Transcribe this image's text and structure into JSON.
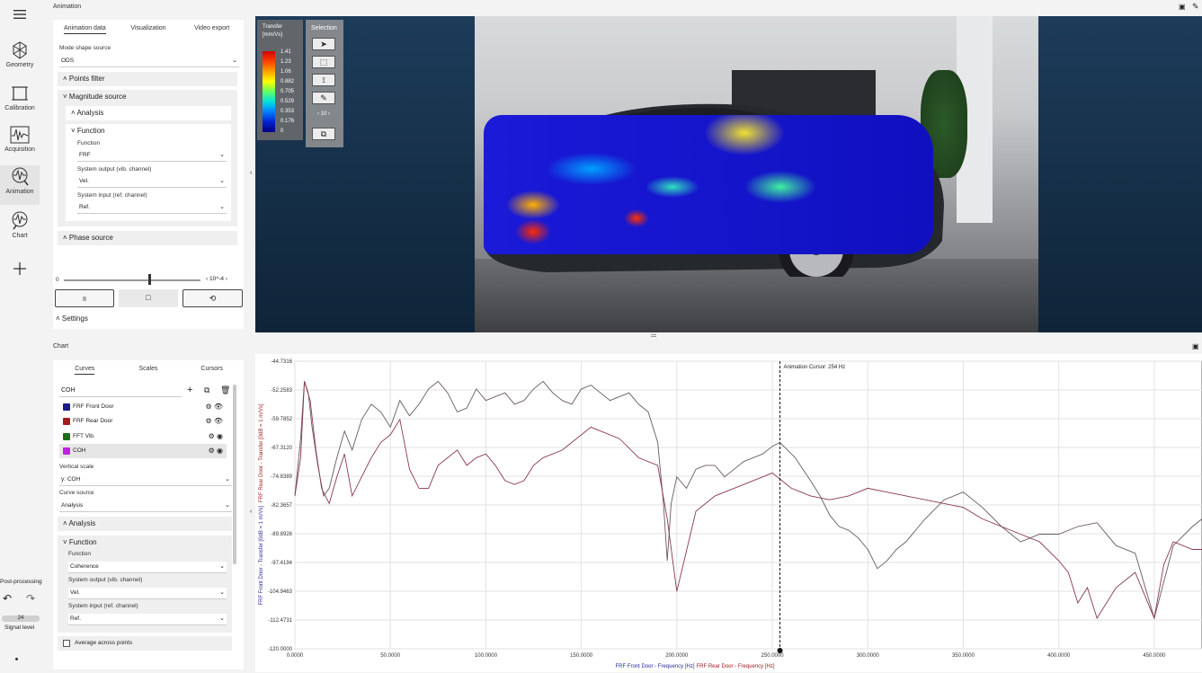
{
  "sidebar": {
    "items": [
      {
        "label": "Geometry",
        "icon": "geometry-icon"
      },
      {
        "label": "Calibration",
        "icon": "calibration-icon"
      },
      {
        "label": "Acquisition",
        "icon": "acquisition-icon"
      },
      {
        "label": "Animation",
        "icon": "animation-icon"
      },
      {
        "label": "Chart",
        "icon": "chart-icon"
      }
    ],
    "post_processing": "Post-processing",
    "signal_value": "24",
    "signal_label": "Signal level"
  },
  "animation": {
    "title": "Animation",
    "tabs": [
      "Animation data",
      "Visualization",
      "Video export"
    ],
    "mode_shape_label": "Mode shape source",
    "mode_shape_value": "ODS",
    "points_filter": "Points filter",
    "magnitude_source": "Magnitude source",
    "analysis": "Analysis",
    "function": "Function",
    "function_label": "Function",
    "function_value": "FRF",
    "sys_output_label": "System output (vib. channel)",
    "sys_output_value": "Vel.",
    "sys_input_label": "System input (ref. channel)",
    "sys_input_value": "Ref.",
    "phase_source": "Phase source",
    "slider_min": "0",
    "slider_fraction": 0.62,
    "slider_value": "10^-4",
    "pause_icon": "II",
    "stop_icon": "□",
    "settings": "Settings"
  },
  "viewport": {
    "legend_title": "Transfer",
    "legend_unit": "[mm/Vs]",
    "legend_ticks": [
      "1.41",
      "1.23",
      "1.06",
      "0.882",
      "0.705",
      "0.529",
      "0.353",
      "0.176",
      "0"
    ],
    "selection_label": "Selection",
    "selection_counter": "10"
  },
  "chart_panel": {
    "title": "Chart",
    "tabs": [
      "Curves",
      "Scales",
      "Cursors"
    ],
    "search_value": "COH",
    "curves": [
      {
        "name": "FRF Front Door",
        "color": "#1a1a8c"
      },
      {
        "name": "FRF Rear Door",
        "color": "#a01c1c"
      },
      {
        "name": "FFT Vib.",
        "color": "#1a6e1a"
      },
      {
        "name": "COH",
        "color": "#c020e0"
      }
    ],
    "vertical_scale_label": "Vertical scale",
    "vertical_scale_value": "y: COH",
    "curve_source_label": "Curve source",
    "curve_source_value": "Analysis",
    "analysis": "Analysis",
    "function": "Function",
    "function_label": "Function",
    "function_value": "Coherence",
    "sys_output_label": "System output (vib. channel)",
    "sys_output_value": "Vel.",
    "sys_input_label": "System input (ref. channel)",
    "sys_input_value": "Ref.",
    "average_label": "Average across points"
  },
  "chart_data": {
    "type": "line",
    "xlabel_front": "FRF Front Door - Frequency [Hz]",
    "xlabel_rear": "FRF Rear Door - Frequency [Hz]",
    "ylabel_front": "FRF Front Door - Transfer [0dB = 1 m/Vs]",
    "ylabel_rear": "FRF Rear Door - Transfer [0dB = 1 m/Vs]",
    "xlim": [
      0,
      475
    ],
    "ylim": [
      -120,
      -44.7316
    ],
    "x_ticks": [
      "0.0000",
      "50.0000",
      "100.0000",
      "150.0000",
      "200.0000",
      "250.0000",
      "300.0000",
      "350.0000",
      "400.0000",
      "450.0000"
    ],
    "x_tick_values": [
      0,
      50,
      100,
      150,
      200,
      250,
      300,
      350,
      400,
      450
    ],
    "y_ticks": [
      "-44.7316",
      "-52.2583",
      "-59.7852",
      "-67.3120",
      "-74.8389",
      "-82.3657",
      "-89.8926",
      "-97.4194",
      "-104.9463",
      "-112.4731",
      "-120.0000"
    ],
    "y_tick_values": [
      -44.7316,
      -52.2583,
      -59.7852,
      -67.312,
      -74.8389,
      -82.3657,
      -89.8926,
      -97.4194,
      -104.9463,
      -112.4731,
      -120
    ],
    "cursor_x": 254,
    "cursor_label": "Animation Cursor: 254 Hz",
    "series": [
      {
        "name": "FRF Front Door",
        "color": "#6a5a60",
        "x": [
          0,
          3,
          5,
          7,
          9,
          12,
          15,
          18,
          22,
          26,
          30,
          35,
          40,
          45,
          50,
          55,
          60,
          65,
          70,
          75,
          80,
          85,
          90,
          95,
          100,
          105,
          110,
          115,
          120,
          125,
          130,
          135,
          140,
          145,
          150,
          155,
          160,
          165,
          170,
          175,
          180,
          185,
          190,
          193,
          195,
          197,
          200,
          205,
          210,
          215,
          220,
          225,
          230,
          235,
          240,
          245,
          250,
          254,
          258,
          262,
          266,
          270,
          275,
          280,
          285,
          290,
          295,
          300,
          305,
          310,
          315,
          320,
          330,
          340,
          350,
          360,
          370,
          380,
          390,
          400,
          410,
          420,
          430,
          440,
          450,
          460,
          470,
          475
        ],
        "y": [
          -80,
          -65,
          -50,
          -53,
          -62,
          -72,
          -80,
          -78,
          -70,
          -63,
          -68,
          -60,
          -56,
          -58,
          -62,
          -55,
          -59,
          -56,
          -52,
          -50,
          -53,
          -58,
          -57,
          -52,
          -55,
          -54,
          -53,
          -56,
          -55,
          -52,
          -50,
          -53,
          -55,
          -56,
          -52,
          -51,
          -53,
          -55,
          -54,
          -53,
          -56,
          -58,
          -66,
          -82,
          -97,
          -82,
          -75,
          -78,
          -73,
          -72,
          -72,
          -75,
          -73,
          -71,
          -70,
          -69,
          -67,
          -66,
          -68,
          -70,
          -73,
          -76,
          -80,
          -85,
          -88,
          -89,
          -91,
          -94,
          -99,
          -97,
          -94,
          -92,
          -86,
          -81,
          -79,
          -83,
          -88,
          -92,
          -90,
          -90,
          -88,
          -87,
          -93,
          -95,
          -112,
          -93,
          -88,
          -86
        ]
      },
      {
        "name": "FRF Rear Door",
        "color": "#8a3a4a",
        "x": [
          0,
          3,
          5,
          8,
          11,
          14,
          18,
          22,
          26,
          30,
          35,
          40,
          45,
          50,
          55,
          60,
          65,
          70,
          75,
          80,
          85,
          90,
          95,
          100,
          105,
          110,
          115,
          120,
          125,
          130,
          135,
          140,
          145,
          150,
          155,
          160,
          170,
          180,
          190,
          195,
          200,
          210,
          220,
          230,
          240,
          250,
          255,
          260,
          270,
          280,
          290,
          300,
          310,
          320,
          330,
          340,
          350,
          360,
          370,
          380,
          390,
          400,
          405,
          410,
          415,
          420,
          430,
          440,
          450,
          455,
          460,
          470,
          475
        ],
        "y": [
          -80,
          -70,
          -50,
          -55,
          -68,
          -78,
          -82,
          -75,
          -69,
          -80,
          -75,
          -70,
          -66,
          -64,
          -60,
          -73,
          -78,
          -78,
          -72,
          -70,
          -68,
          -72,
          -70,
          -69,
          -72,
          -76,
          -77,
          -76,
          -72,
          -70,
          -69,
          -68,
          -66,
          -64,
          -62,
          -63,
          -65,
          -70,
          -72,
          -86,
          -105,
          -84,
          -80,
          -78,
          -76,
          -74,
          -76,
          -78,
          -80,
          -81,
          -80,
          -78,
          -79,
          -80,
          -81,
          -82,
          -83,
          -86,
          -88,
          -90,
          -92,
          -97,
          -100,
          -108,
          -104,
          -112,
          -104,
          -100,
          -112,
          -98,
          -92,
          -94,
          -94
        ]
      }
    ]
  }
}
